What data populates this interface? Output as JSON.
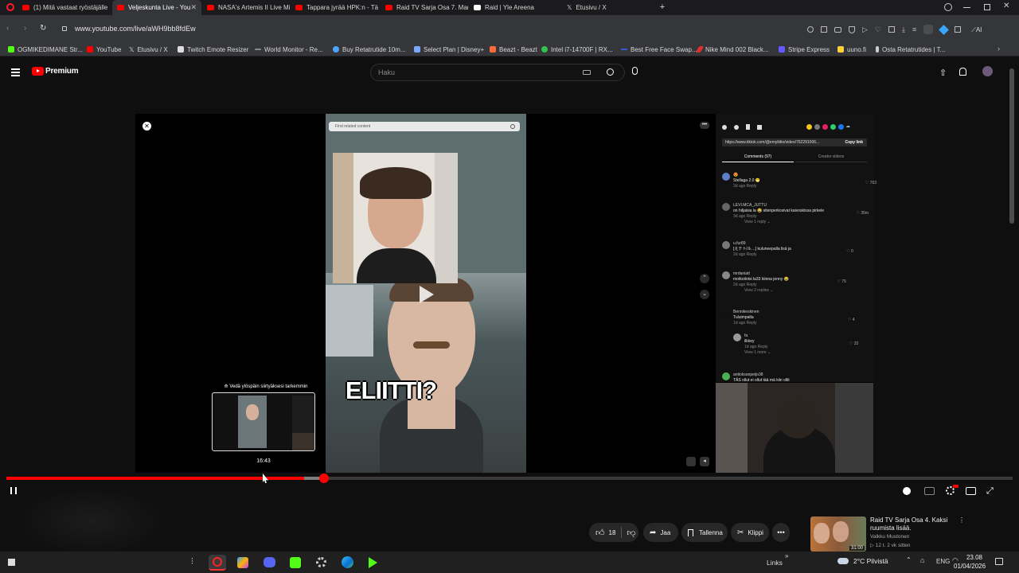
{
  "browser": {
    "tabs": [
      {
        "title": "(1) Mitä vastaat ryöstäjälle",
        "color": "#ff0000"
      },
      {
        "title": "Veljeskunta Live - You",
        "color": "#ff0000",
        "active": true
      },
      {
        "title": "NASA's Artemis II Live Mi",
        "color": "#ff0000"
      },
      {
        "title": "Tappara jyrää HPK:n - Tä",
        "color": "#ff0000"
      },
      {
        "title": "Raid TV Sarja Osa 7. Mara",
        "color": "#ff0000"
      },
      {
        "title": "Raid | Yle Areena",
        "color": "#ffffff"
      },
      {
        "title": "Etusivu / X",
        "color": "#ffffff"
      }
    ],
    "url": "www.youtube.com/live/aWH9bb8fdEw",
    "bookmarks": [
      {
        "label": "OGMIKEDIMANE Str...",
        "color": "#53fc18"
      },
      {
        "label": "YouTube",
        "color": "#ff0000"
      },
      {
        "label": "Etusivu / X",
        "color": "#ffffff"
      },
      {
        "label": "Twitch Emote Resizer",
        "color": "#dddddd"
      },
      {
        "label": "World Monitor - Re...",
        "color": "#bbbbbb"
      },
      {
        "label": "Buy Retatrutide 10m...",
        "color": "#4ea3ff"
      },
      {
        "label": "Select Plan | Disney+",
        "color": "#7aa7ff"
      },
      {
        "label": "Beazt - Beazt",
        "color": "#ff6a3a"
      },
      {
        "label": "Intel i7-14700F | RX...",
        "color": "#32c24d"
      },
      {
        "label": "Best Free Face Swap...",
        "color": "#3a5bd9"
      },
      {
        "label": "Nike Mind 002 Black...",
        "color": "#e0302a"
      },
      {
        "label": "Stripe Express",
        "color": "#635bff"
      },
      {
        "label": "uuno.fi",
        "color": "#ffd23a"
      },
      {
        "label": "Osta Retatrutides | T...",
        "color": "#cccccc"
      }
    ]
  },
  "youtube": {
    "logo": "Premium",
    "search_placeholder": "Haku",
    "colors": {
      "accent": "#ff0000",
      "bg": "#0f0f0f"
    }
  },
  "video": {
    "search_text": "Find related content",
    "caption": "ELIITTI?",
    "link": "https://www.tiktok.com/@emyliitto/video/762291006...",
    "copy_link": "Copy link",
    "tab_comments": "Comments (97)",
    "tab_creator": "Creator videos",
    "comments": [
      {
        "user": "😍",
        "text": "Stellaga 2.0 😁",
        "meta": "3d ago   Reply",
        "likes": "♡ 763"
      },
      {
        "user": "LEVI.MCA_JUTTU",
        "text": "on hiljaisia la 😂 sitenperkosivat kaivoskissa pirkele",
        "meta": "3d ago   Reply",
        "likes": "♡ 35m",
        "replies": "View 1 reply ⌄"
      },
      {
        "user": "u.fur89",
        "text": "[えテト/ル…] kuluneepalla lisä ja",
        "meta": "2d ago   Reply",
        "likes": "♡ 0"
      },
      {
        "user": "mrdaniatt",
        "text": "motkoilotsi la33 kiinna jenny 😂",
        "meta": "2d ago   Reply",
        "likes": "♡ 75",
        "replies": "View 2 replies ⌄"
      },
      {
        "user": "Bennikeskinen",
        "text": "Tuluimpalta",
        "meta": "1d ago   Reply",
        "likes": "♡ 4"
      },
      {
        "user": "fa",
        "text": "ilkkey",
        "meta": "1d ago   Reply",
        "likes": "♡ 33",
        "replies": "View 1 more ⌄"
      },
      {
        "user": "antioksanpeijo38",
        "text": "TÄS ollut ei ollut tää mä kiin ollit"
      }
    ],
    "preview_label": "⟰ Vedä ylöspäin siirtyäksesi tarkemmin",
    "preview_time": "16:43",
    "progress": {
      "played": 0.296,
      "buffered": 0.316
    }
  },
  "actions": {
    "likes": "18",
    "share": "Jaa",
    "save": "Tallenna",
    "clip": "Klippi"
  },
  "recommended": {
    "title": "Raid TV Sarja Osa 4. Kaksi ruumista lisää.",
    "channel": "Valkku Mustonen",
    "meta": "▷ 12 t.   2 vk sitten",
    "duration": "31:00"
  },
  "taskbar": {
    "links": "Links",
    "weather": "2°C  Pilvistä",
    "lang": "ENG",
    "time": "23.08",
    "date": "01/04/2026"
  }
}
